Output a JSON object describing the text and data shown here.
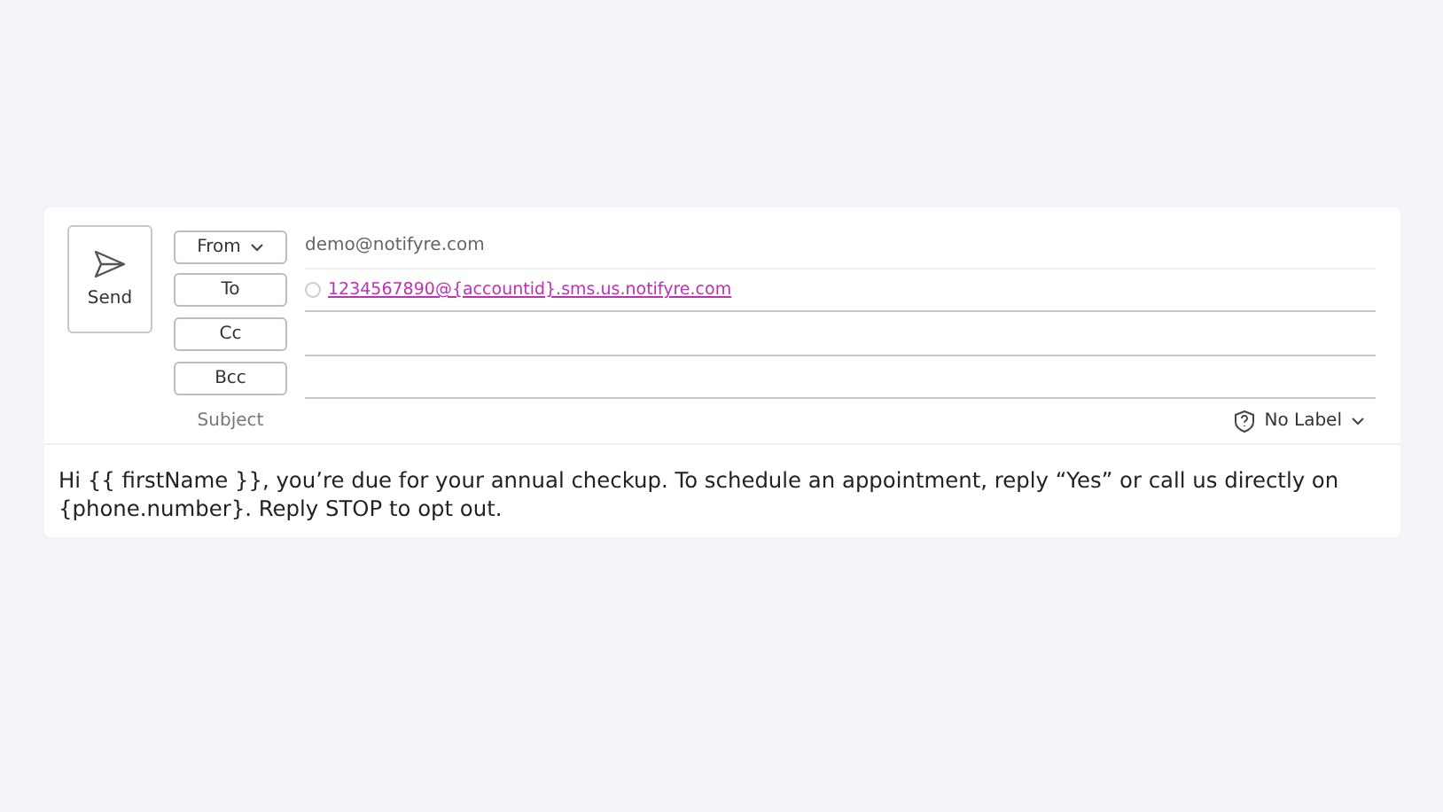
{
  "compose": {
    "send_label": "Send",
    "from": {
      "label": "From",
      "value": "demo@notifyre.com"
    },
    "to": {
      "label": "To",
      "recipients": [
        "1234567890@{accountid}.sms.us.notifyre.com"
      ]
    },
    "cc": {
      "label": "Cc"
    },
    "bcc": {
      "label": "Bcc"
    },
    "subject": {
      "placeholder": "Subject"
    },
    "sensitivity": {
      "label": "No Label"
    },
    "body": "Hi {{ firstName }}, you’re due for your annual checkup. To schedule an appointment, reply “Yes” or call us directly on {phone.number}. Reply STOP to opt out."
  }
}
